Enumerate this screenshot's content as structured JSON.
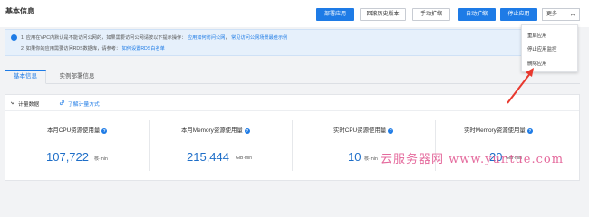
{
  "header": {
    "title": "基本信息"
  },
  "toolbar": {
    "buttons": [
      {
        "label": "部署应用",
        "primary": true
      },
      {
        "label": "回滚历史版本",
        "primary": false
      },
      {
        "label": "手动扩缩",
        "primary": false
      },
      {
        "label": "自动扩缩",
        "primary": true
      },
      {
        "label": "停止应用",
        "primary": true
      }
    ],
    "more_label": "更多"
  },
  "more_menu": {
    "items": [
      "重启应用",
      "停止应用监控",
      "删除应用"
    ]
  },
  "notice": {
    "line1_text": "1. 应用在VPC内默认是不能访问公网的，如果需要访问公网请按以下提示操作：",
    "line1_link1": "应用如何访问公网",
    "line1_link2": "常见访问公网场景最佳示例",
    "line2_text": "2. 如果你的应用需要访问RDS数据库，请参考：",
    "line2_link": "如何设置RDS白名单"
  },
  "tabs": [
    {
      "label": "基本信息",
      "active": true
    },
    {
      "label": "实例部署信息",
      "active": false
    }
  ],
  "panel": {
    "title": "计量数据",
    "link_label": "了解计量方式",
    "metrics": [
      {
        "label": "本月CPU资源使用量",
        "value": "107,722",
        "unit": "核·min"
      },
      {
        "label": "本月Memory资源使用量",
        "value": "215,444",
        "unit": "GiB·min"
      },
      {
        "label": "实时CPU资源使用量",
        "value": "10",
        "unit": "核·min"
      },
      {
        "label": "实时Memory资源使用量",
        "value": "20",
        "unit": "GiB·min"
      }
    ]
  },
  "watermark": "云服务器网 www.yuntue.com",
  "colors": {
    "primary": "#1e7be6",
    "arrow": "#e8392f",
    "watermark": "#e04f8b"
  }
}
